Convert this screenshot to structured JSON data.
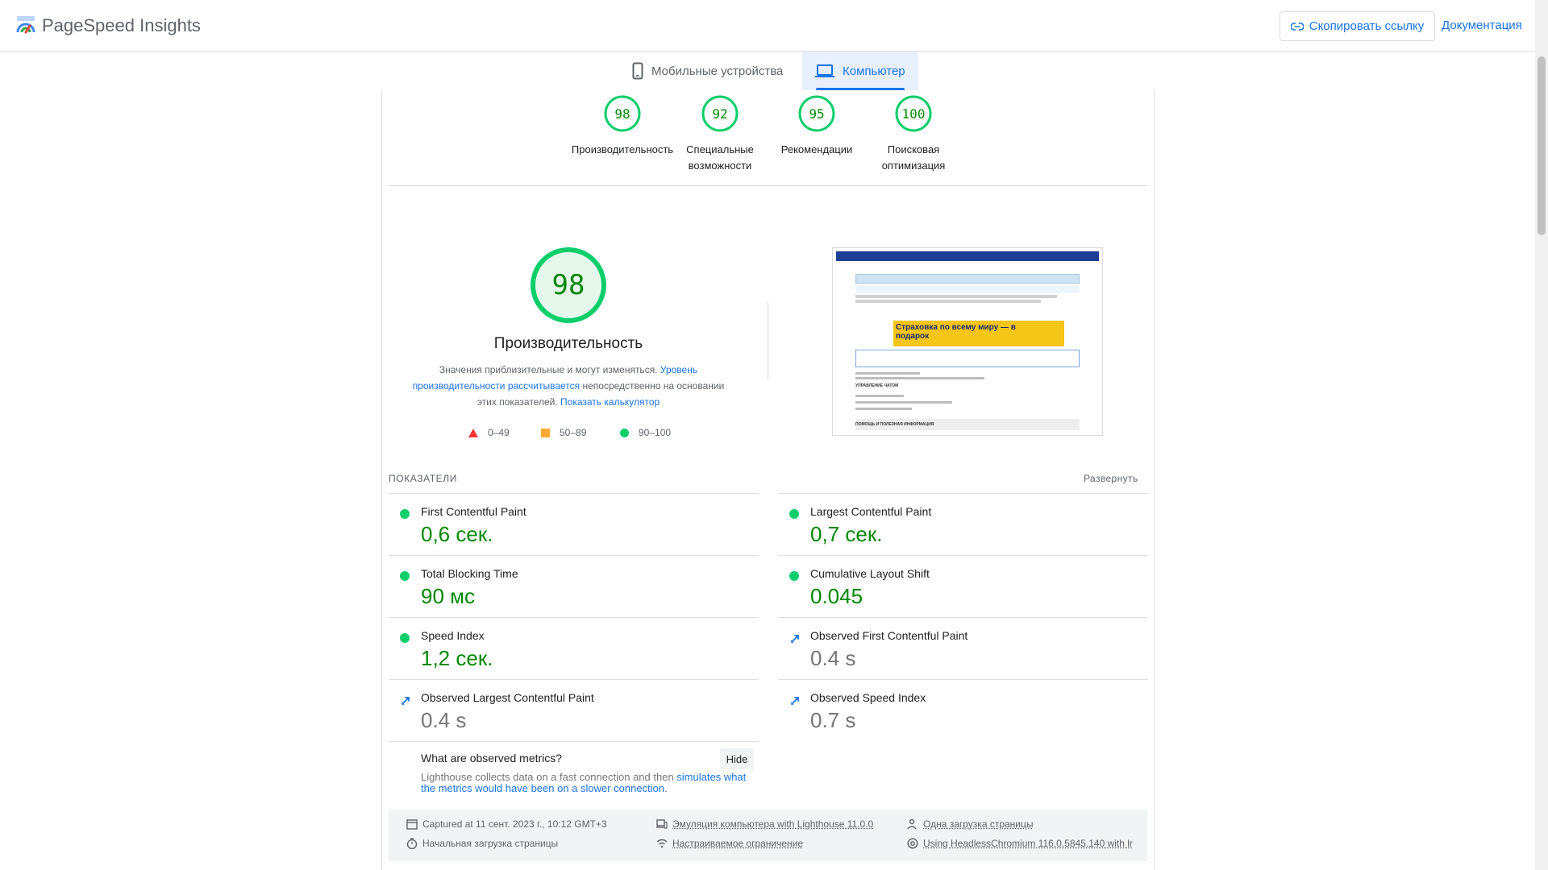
{
  "header": {
    "brand": "PageSpeed Insights",
    "copy_link": "Скопировать ссылку",
    "docs": "Документация"
  },
  "tabs": {
    "mobile": "Мобильные устройства",
    "desktop": "Компьютер",
    "active": "desktop"
  },
  "categories": [
    {
      "score": "98",
      "label": "Производительность"
    },
    {
      "score": "92",
      "label": "Специальные возможности"
    },
    {
      "score": "95",
      "label": "Рекомендации"
    },
    {
      "score": "100",
      "label": "Поисковая оптимизация"
    }
  ],
  "performance": {
    "score": "98",
    "title": "Производительность",
    "disclaimer_1": "Значения приблизительные и могут изменяться.",
    "disclaimer_link_1": "Уровень производительности рассчитывается",
    "disclaimer_2": "непосредственно на основании этих показателей.",
    "disclaimer_link_2": "Показать калькулятор",
    "legend": {
      "fail": "0–49",
      "average": "50–89",
      "pass": "90–100"
    }
  },
  "thumbnail": {
    "banner_text": "Страховка по всему миру — в подарок",
    "section_1": "УПРАВЛЕНИЕ ЧАТОМ",
    "section_2": "ПОМОЩЬ И ПОЛЕЗНАЯ ИНФОРМАЦИЯ"
  },
  "metrics": {
    "title": "ПОКАЗАТЕЛИ",
    "expand": "Развернуть",
    "items": [
      {
        "name": "First Contentful Paint",
        "value": "0,6 сек.",
        "status": "pass"
      },
      {
        "name": "Largest Contentful Paint",
        "value": "0,7 сек.",
        "status": "pass"
      },
      {
        "name": "Total Blocking Time",
        "value": "90 мс",
        "status": "pass"
      },
      {
        "name": "Cumulative Layout Shift",
        "value": "0.045",
        "status": "pass"
      },
      {
        "name": "Speed Index",
        "value": "1,2 сек.",
        "status": "pass"
      },
      {
        "name": "Observed First Contentful Paint",
        "value": "0.4 s",
        "status": "observed"
      },
      {
        "name": "Observed Largest Contentful Paint",
        "value": "0.4 s",
        "status": "observed"
      },
      {
        "name": "Observed Speed Index",
        "value": "0.7 s",
        "status": "observed"
      }
    ]
  },
  "observed": {
    "question": "What are observed metrics?",
    "hide": "Hide",
    "desc_1": "Lighthouse collects data on a fast connection and then",
    "desc_link": "simulates what the metrics would have been on a slower connection."
  },
  "runtime": {
    "captured": "Captured at 11 сент. 2023 г., 10:12 GMT+3",
    "emulation": "Эмуляция компьютера with Lighthouse 11.0.0",
    "single_load": "Одна загрузка страницы",
    "initial_load": "Начальная загрузка страницы",
    "throttling": "Настраиваемое ограничение",
    "browser": "Using HeadlessChromium 116.0.5845.140 with lr"
  },
  "colors": {
    "pass": "#0cce6b",
    "pass_text": "#008800",
    "average": "#ffaa33",
    "fail": "#ff3333",
    "accent": "#1a73e8"
  }
}
